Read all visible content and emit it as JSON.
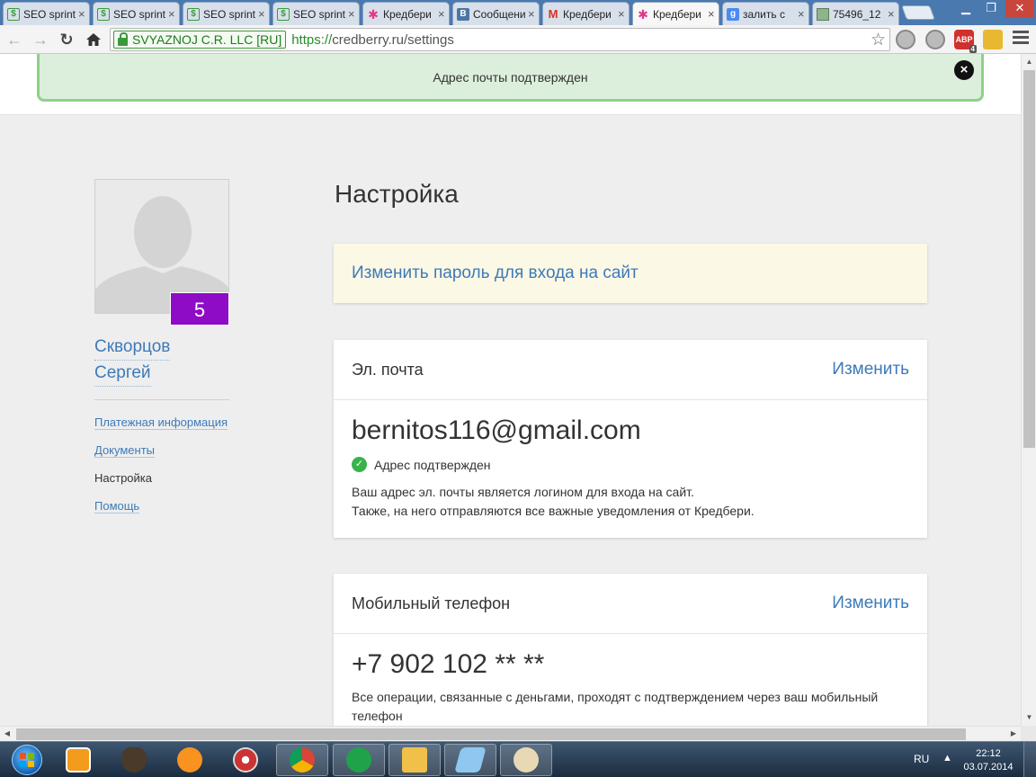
{
  "browser": {
    "tabs": [
      {
        "title": "SEO sprint",
        "icon": "seosprint-favicon-icon",
        "active": false
      },
      {
        "title": "SEO sprint",
        "icon": "seosprint-favicon-icon",
        "active": false
      },
      {
        "title": "SEO sprint",
        "icon": "seosprint-favicon-icon",
        "active": false
      },
      {
        "title": "SEO sprint",
        "icon": "seosprint-favicon-icon",
        "active": false
      },
      {
        "title": "Кредбери",
        "icon": "credberry-favicon-icon",
        "active": false
      },
      {
        "title": "Сообщения",
        "icon": "vk-favicon-icon",
        "active": false
      },
      {
        "title": "Кредбери",
        "icon": "gmail-favicon-icon",
        "active": false
      },
      {
        "title": "Кредбери",
        "icon": "credberry-favicon-icon",
        "active": true
      },
      {
        "title": "залить с",
        "icon": "google-favicon-icon",
        "active": false
      },
      {
        "title": "75496_12",
        "icon": "image-favicon-icon",
        "active": false
      }
    ],
    "tab_close": "×",
    "ev_certificate": "SVYAZNOJ C.R. LLC [RU]",
    "url_scheme": "https://",
    "url_rest": "credberry.ru/settings",
    "adblock_label": "ABP",
    "adblock_badge": "4"
  },
  "notice": {
    "text": "Адрес почты подтвержден",
    "close": "×"
  },
  "profile": {
    "level": "5",
    "last_name": "Скворцов",
    "first_name": "Сергей",
    "nav": [
      {
        "label": "Платежная информация",
        "current": false
      },
      {
        "label": "Документы",
        "current": false
      },
      {
        "label": "Настройка",
        "current": true
      },
      {
        "label": "Помощь",
        "current": false
      }
    ]
  },
  "settings": {
    "title": "Настройка",
    "change_password": "Изменить пароль для входа на сайт",
    "email": {
      "label": "Эл. почта",
      "action": "Изменить",
      "value": "bernitos116@gmail.com",
      "status": "Адрес подтвержден",
      "desc_line1": "Ваш адрес эл. почты является логином для входа на сайт.",
      "desc_line2": "Также, на него отправляются все важные уведомления от Кредбери."
    },
    "phone": {
      "label": "Мобильный телефон",
      "action": "Изменить",
      "value": "+7 902 102 ** **",
      "desc_line1": "Все операции, связанные с деньгами, проходят с подтверждением через ваш мобильный",
      "desc_line2": "телефон"
    }
  },
  "taskbar": {
    "language": "RU",
    "time": "22:12",
    "date": "03.07.2014"
  },
  "colors": {
    "link": "#3d7ab8",
    "level_badge": "#8f0cc6",
    "notice_bg": "#dcefdc",
    "notice_border": "#8fd08a",
    "verified_green": "#37b34a"
  }
}
